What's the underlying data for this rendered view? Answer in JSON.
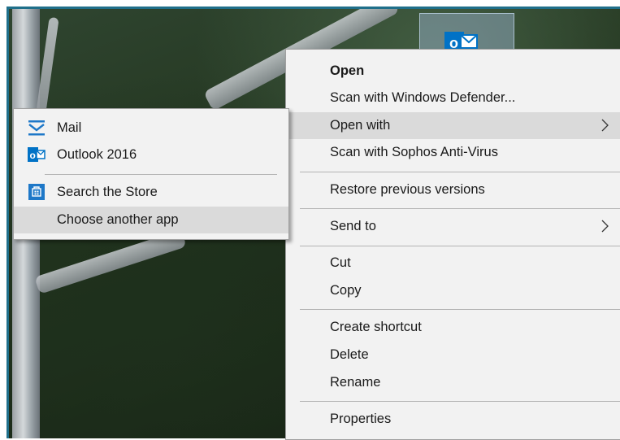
{
  "context_menu": {
    "items": [
      {
        "label": "Open"
      },
      {
        "label": "Scan with Windows Defender..."
      },
      {
        "label": "Open with"
      },
      {
        "label": "Scan with Sophos Anti-Virus"
      },
      {
        "label": "Restore previous versions"
      },
      {
        "label": "Send to"
      },
      {
        "label": "Cut"
      },
      {
        "label": "Copy"
      },
      {
        "label": "Create shortcut"
      },
      {
        "label": "Delete"
      },
      {
        "label": "Rename"
      },
      {
        "label": "Properties"
      }
    ]
  },
  "open_with_submenu": {
    "items": [
      {
        "label": "Mail",
        "icon": "mail-icon"
      },
      {
        "label": "Outlook 2016",
        "icon": "outlook-icon"
      },
      {
        "label": "Search the Store",
        "icon": "store-icon"
      },
      {
        "label": "Choose another app"
      }
    ]
  },
  "colors": {
    "menu_background": "#f2f2f2",
    "highlight": "#dadada",
    "outlook_blue": "#0072c6",
    "separator": "#b4b4b4"
  }
}
